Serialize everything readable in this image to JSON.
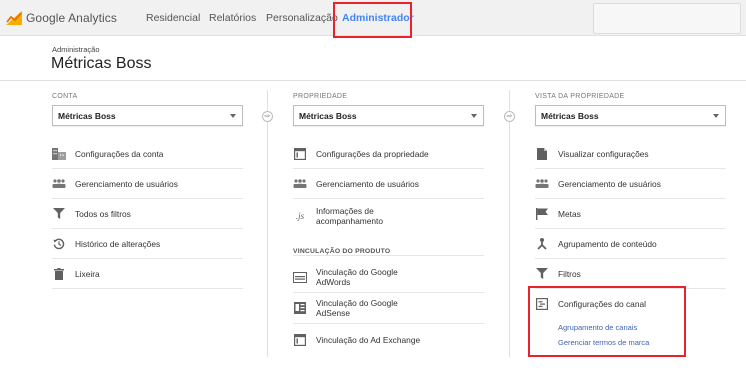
{
  "header": {
    "brand": "Google Analytics",
    "nav": [
      "Residencial",
      "Relatórios",
      "Personalização",
      "Administrador"
    ],
    "active_index": 3
  },
  "page": {
    "breadcrumb": "Administração",
    "title": "Métricas Boss"
  },
  "columns": {
    "account": {
      "label": "CONTA",
      "selected": "Métricas Boss",
      "items": [
        "Configurações da conta",
        "Gerenciamento de usuários",
        "Todos os filtros",
        "Histórico de alterações",
        "Lixeira"
      ]
    },
    "property": {
      "label": "PROPRIEDADE",
      "selected": "Métricas Boss",
      "items": [
        "Configurações da propriedade",
        "Gerenciamento de usuários",
        "Informações de acompanhamento"
      ],
      "product_section": "VINCULAÇÃO DO PRODUTO",
      "product_items": [
        "Vinculação do Google AdWords",
        "Vinculação do Google AdSense",
        "Vinculação do Ad Exchange"
      ]
    },
    "view": {
      "label": "VISTA DA PROPRIEDADE",
      "selected": "Métricas Boss",
      "items": [
        "Visualizar configurações",
        "Gerenciamento de usuários",
        "Metas",
        "Agrupamento de conteúdo",
        "Filtros",
        "Configurações do canal"
      ],
      "channel_subitems": [
        "Agrupamento de canais",
        "Gerenciar termos de marca"
      ]
    }
  },
  "colors": {
    "accent": "#4285f4",
    "highlight": "#e8232d",
    "link": "#4264b0",
    "logo_orange": "#f9ab00",
    "logo_dark": "#e37400"
  }
}
